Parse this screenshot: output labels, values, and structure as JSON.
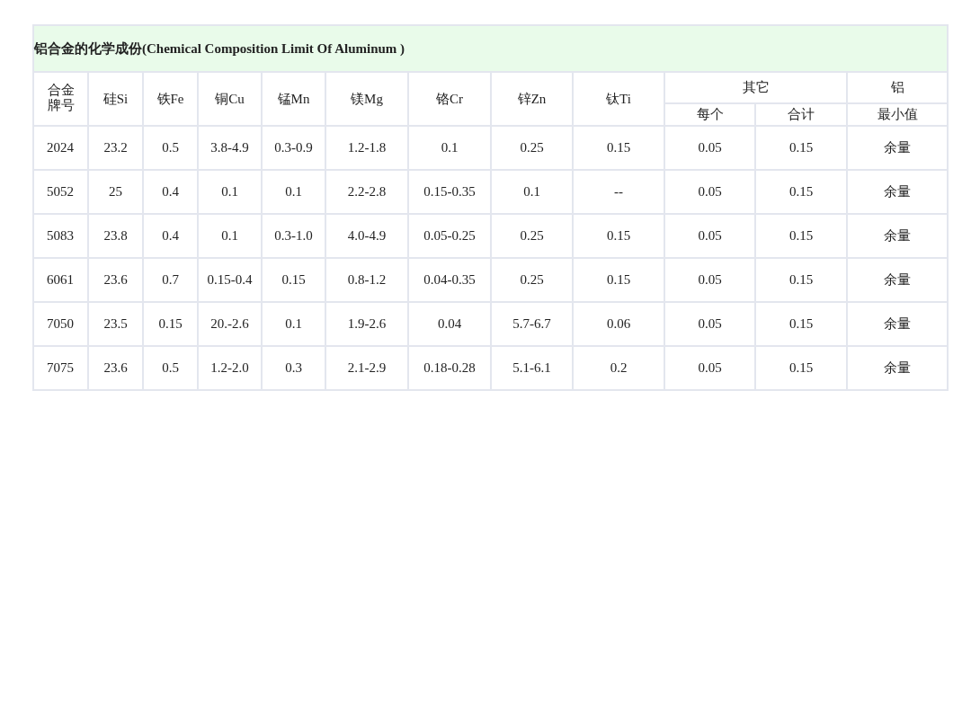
{
  "table": {
    "title": "铝合金的化学成份(Chemical Composition Limit Of Aluminum )",
    "columns": [
      {
        "label": "合金牌号"
      },
      {
        "label": "硅Si"
      },
      {
        "label": "铁Fe"
      },
      {
        "label": "铜Cu"
      },
      {
        "label": "锰Mn"
      },
      {
        "label": "镁Mg"
      },
      {
        "label": "铬Cr"
      },
      {
        "label": "锌Zn"
      },
      {
        "label": "钛Ti"
      },
      {
        "label": "其它",
        "colspan": 2,
        "subcolumns": [
          "每个",
          "合计"
        ]
      },
      {
        "label": "铝",
        "subcolumns": [
          "最小值"
        ]
      }
    ],
    "rows": [
      [
        "2024",
        "23.2",
        "0.5",
        "3.8-4.9",
        "0.3-0.9",
        "1.2-1.8",
        "0.1",
        "0.25",
        "0.15",
        "0.05",
        "0.15",
        "余量"
      ],
      [
        "5052",
        "25",
        "0.4",
        "0.1",
        "0.1",
        "2.2-2.8",
        "0.15-0.35",
        "0.1",
        "--",
        "0.05",
        "0.15",
        "余量"
      ],
      [
        "5083",
        "23.8",
        "0.4",
        "0.1",
        "0.3-1.0",
        "4.0-4.9",
        "0.05-0.25",
        "0.25",
        "0.15",
        "0.05",
        "0.15",
        "余量"
      ],
      [
        "6061",
        "23.6",
        "0.7",
        "0.15-0.4",
        "0.15",
        "0.8-1.2",
        "0.04-0.35",
        "0.25",
        "0.15",
        "0.05",
        "0.15",
        "余量"
      ],
      [
        "7050",
        "23.5",
        "0.15",
        "20.-2.6",
        "0.1",
        "1.9-2.6",
        "0.04",
        "5.7-6.7",
        "0.06",
        "0.05",
        "0.15",
        "余量"
      ],
      [
        "7075",
        "23.6",
        "0.5",
        "1.2-2.0",
        "0.3",
        "2.1-2.9",
        "0.18-0.28",
        "5.1-6.1",
        "0.2",
        "0.05",
        "0.15",
        "余量"
      ]
    ]
  }
}
